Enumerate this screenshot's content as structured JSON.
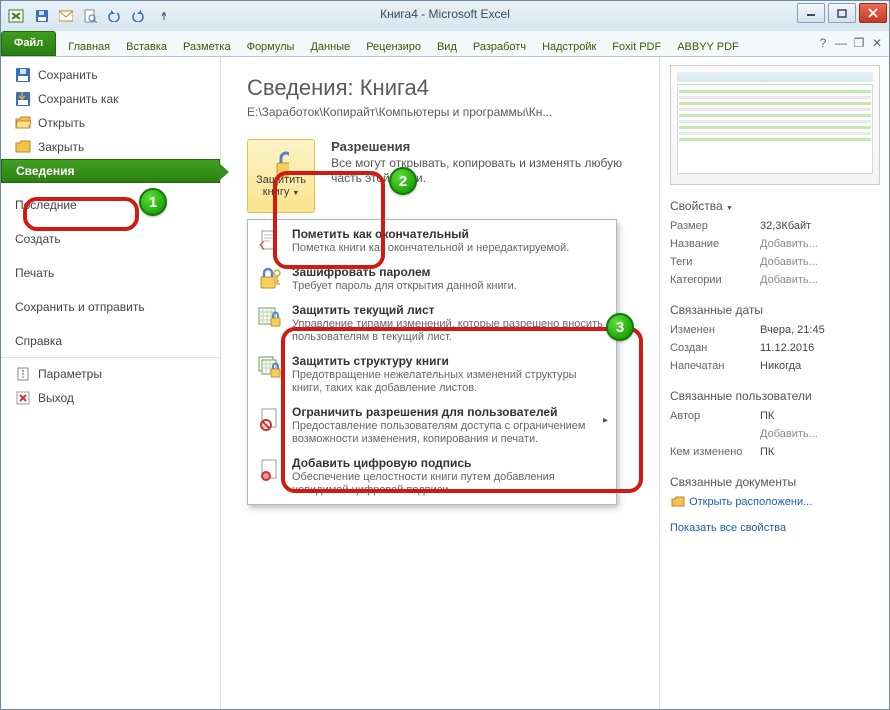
{
  "window": {
    "title": "Книга4 - Microsoft Excel"
  },
  "ribbon": {
    "file": "Файл",
    "tabs": [
      "Главная",
      "Вставка",
      "Разметка",
      "Формулы",
      "Данные",
      "Рецензиро",
      "Вид",
      "Разработч",
      "Надстройк",
      "Foxit PDF",
      "ABBYY PDF"
    ]
  },
  "backstage_items": {
    "save": "Сохранить",
    "save_as": "Сохранить как",
    "open": "Открыть",
    "close": "Закрыть",
    "info": "Сведения",
    "recent": "Последние",
    "new": "Создать",
    "print": "Печать",
    "share": "Сохранить и отправить",
    "help": "Справка",
    "options": "Параметры",
    "exit": "Выход"
  },
  "info": {
    "title": "Сведения: Книга4",
    "path": "E:\\Заработок\\Копирайт\\Компьютеры и программы\\Кн...",
    "protect_button": "Защитить книгу",
    "permissions_h": "Разрешения",
    "permissions_t": "Все могут открывать, копировать и изменять любую часть этой книги."
  },
  "menu": {
    "final_t": "Пометить как окончательный",
    "final_s": "Пометка книги как окончательной и нередактируемой.",
    "encrypt_t": "Зашифровать паролем",
    "encrypt_s": "Требует пароль для открытия данной книги.",
    "sheet_t": "Защитить текущий лист",
    "sheet_s": "Управление типами изменений, которые разрешено вносить пользователям в текущий лист.",
    "struct_t": "Защитить структуру книги",
    "struct_s": "Предотвращение нежелательных изменений структуры книги, таких как добавление листов.",
    "restrict_t": "Ограничить разрешения для пользователей",
    "restrict_s": "Предоставление пользователям доступа с ограничением возможности изменения, копирования и печати.",
    "sign_t": "Добавить цифровую подпись",
    "sign_s": "Обеспечение целостности книги путем добавления невидимой цифровой подписи."
  },
  "props": {
    "header": "Свойства",
    "size_k": "Размер",
    "size_v": "32,3Кбайт",
    "name_k": "Название",
    "add": "Добавить...",
    "tags_k": "Теги",
    "cats_k": "Категории",
    "dates_h": "Связанные даты",
    "mod_k": "Изменен",
    "mod_v": "Вчера, 21:45",
    "created_k": "Создан",
    "created_v": "11.12.2016",
    "printed_k": "Напечатан",
    "printed_v": "Никогда",
    "users_h": "Связанные пользователи",
    "author_k": "Автор",
    "author_v": "ПК",
    "changed_k": "Кем изменено",
    "changed_v": "ПК",
    "docs_h": "Связанные документы",
    "open_loc": "Открыть расположени...",
    "show_all": "Показать все свойства"
  },
  "markers": {
    "m1": "1",
    "m2": "2",
    "m3": "3"
  }
}
